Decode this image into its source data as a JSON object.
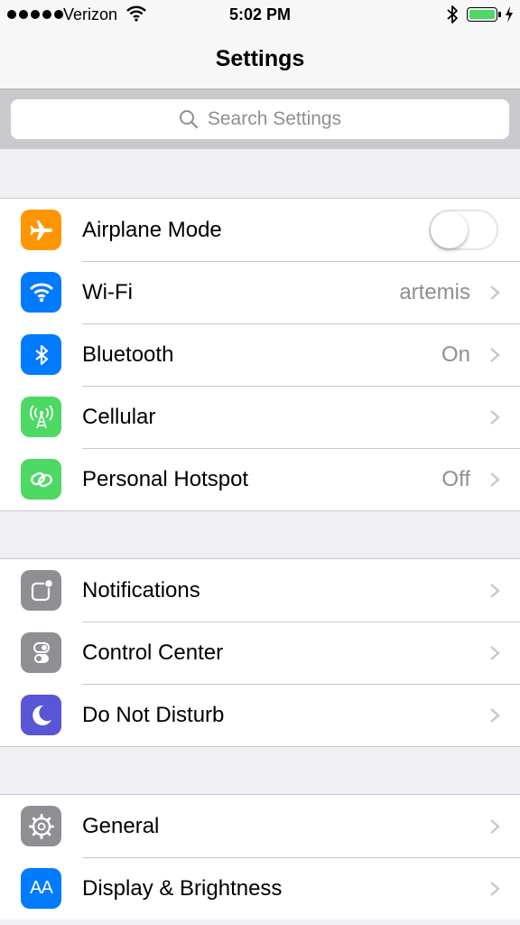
{
  "status_bar": {
    "carrier": "Verizon",
    "time": "5:02 PM",
    "battery_color": "#4cd964"
  },
  "nav": {
    "title": "Settings"
  },
  "search": {
    "placeholder": "Search Settings"
  },
  "groups": [
    {
      "rows": [
        {
          "label": "Airplane Mode",
          "icon": "airplane-icon",
          "icon_color": "#ff9500",
          "control": "toggle",
          "toggle_on": false
        },
        {
          "label": "Wi-Fi",
          "value": "artemis",
          "icon": "wifi-icon",
          "icon_color": "#007aff"
        },
        {
          "label": "Bluetooth",
          "value": "On",
          "icon": "bluetooth-icon",
          "icon_color": "#007aff"
        },
        {
          "label": "Cellular",
          "icon": "cellular-antenna-icon",
          "icon_color": "#4cd964"
        },
        {
          "label": "Personal Hotspot",
          "value": "Off",
          "icon": "hotspot-link-icon",
          "icon_color": "#4cd964"
        }
      ]
    },
    {
      "rows": [
        {
          "label": "Notifications",
          "icon": "notifications-icon",
          "icon_color": "#8e8e93"
        },
        {
          "label": "Control Center",
          "icon": "control-center-icon",
          "icon_color": "#8e8e93"
        },
        {
          "label": "Do Not Disturb",
          "icon": "moon-icon",
          "icon_color": "#5856d6"
        }
      ]
    },
    {
      "rows": [
        {
          "label": "General",
          "icon": "gear-icon",
          "icon_color": "#8e8e93"
        },
        {
          "label": "Display & Brightness",
          "icon": "display-aa-icon",
          "icon_color": "#007aff",
          "icon_text": "AA"
        }
      ]
    }
  ]
}
